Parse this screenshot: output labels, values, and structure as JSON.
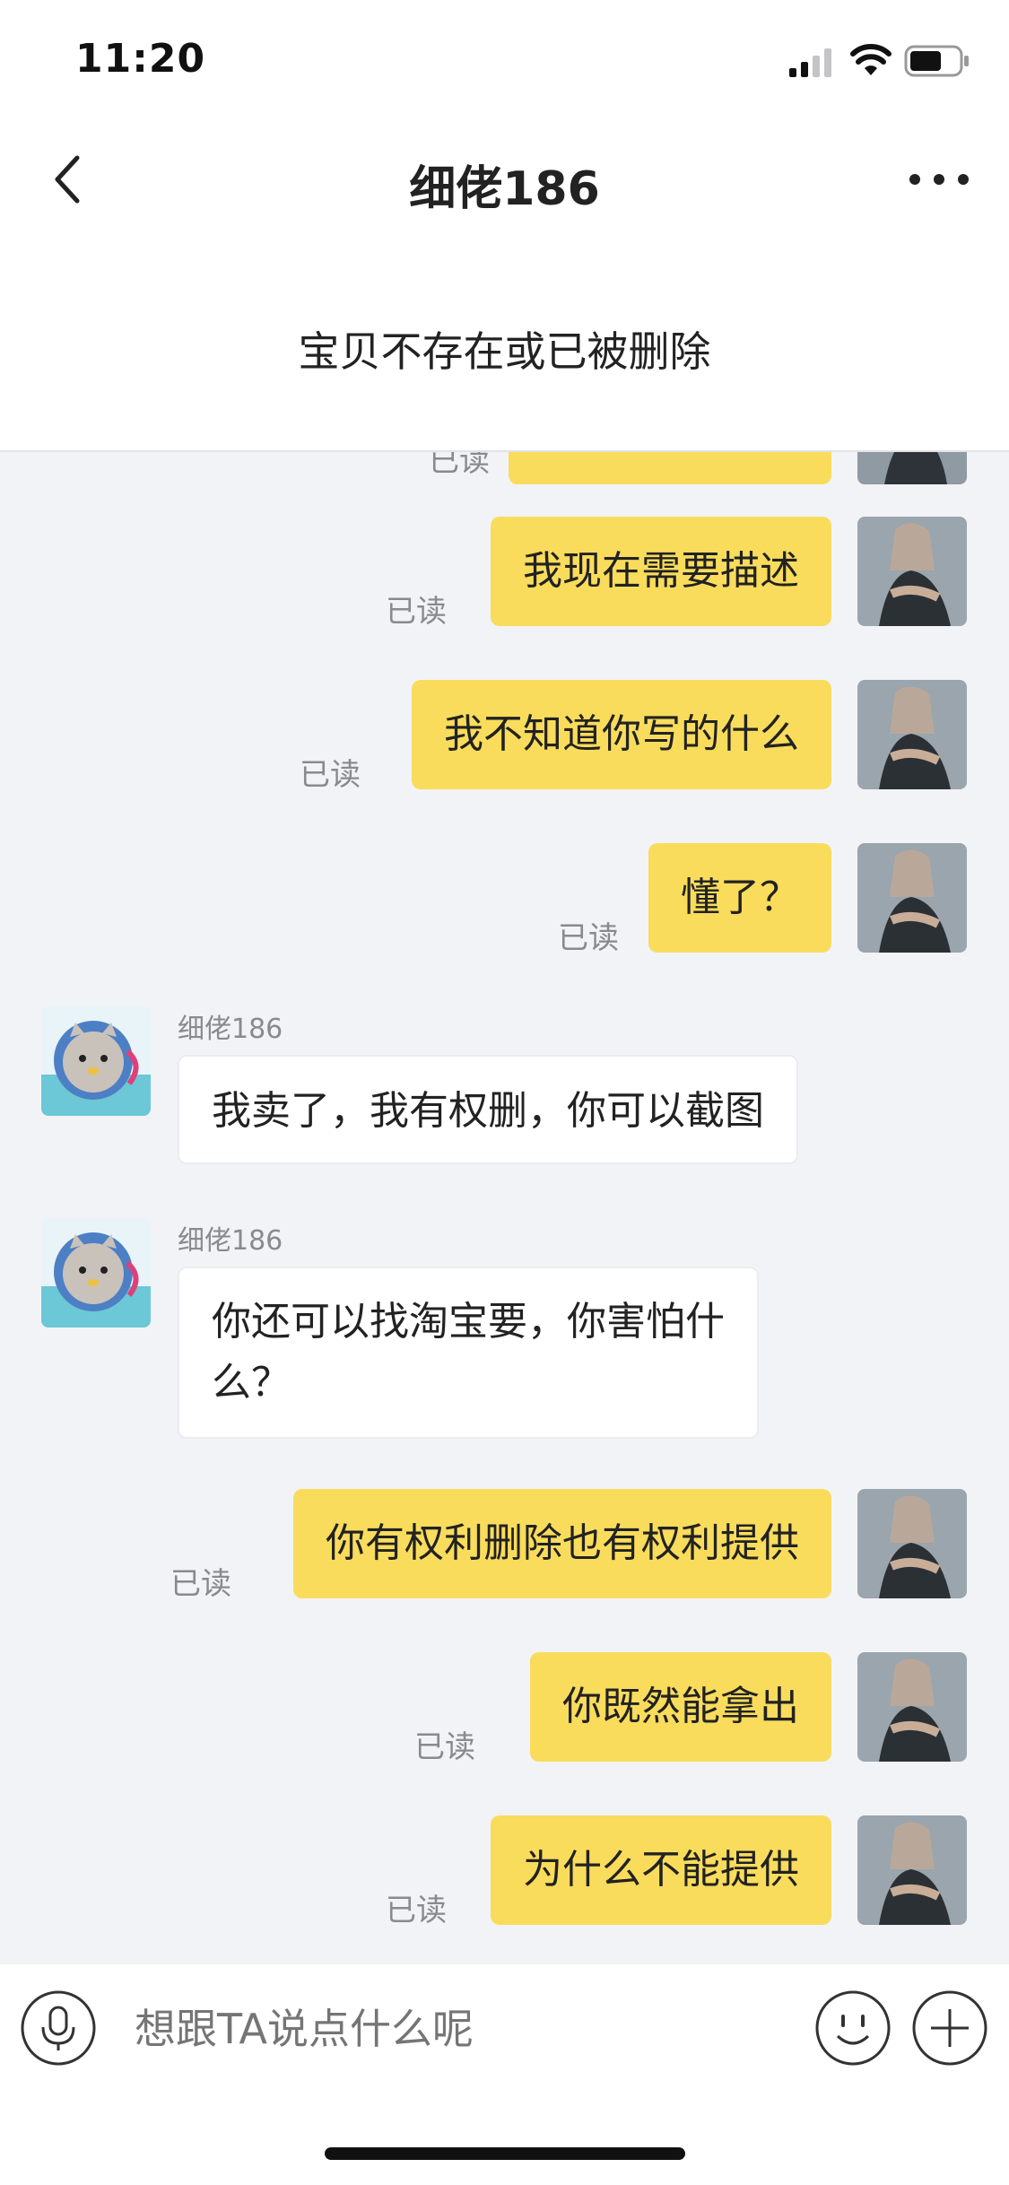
{
  "status_bar": {
    "time": "11:20"
  },
  "header": {
    "title": "细佬186"
  },
  "banner": {
    "text": "宝贝不存在或已被删除"
  },
  "messages": [
    {
      "side": "mine",
      "text": "我现在需要描述",
      "status": "已读"
    },
    {
      "side": "mine",
      "text": "我不知道你写的什么",
      "status": "已读"
    },
    {
      "side": "mine",
      "text": "懂了？",
      "status": "已读"
    },
    {
      "side": "theirs",
      "sender": "细佬186",
      "text": "我卖了，我有权删，你可以截图"
    },
    {
      "side": "theirs",
      "sender": "细佬186",
      "text": "你还可以找淘宝要，你害怕什么？"
    },
    {
      "side": "mine",
      "text": "你有权利删除也有权利提供",
      "status": "已读"
    },
    {
      "side": "mine",
      "text": "你既然能拿出",
      "status": "已读"
    },
    {
      "side": "mine",
      "text": "为什么不能提供",
      "status": "已读"
    }
  ],
  "partial_message": {
    "status": "已读"
  },
  "input": {
    "placeholder": "想跟TA说点什么呢"
  },
  "colors": {
    "my_bubble": "#f9dc5c",
    "their_bubble": "#ffffff",
    "background": "#f2f3f7"
  }
}
